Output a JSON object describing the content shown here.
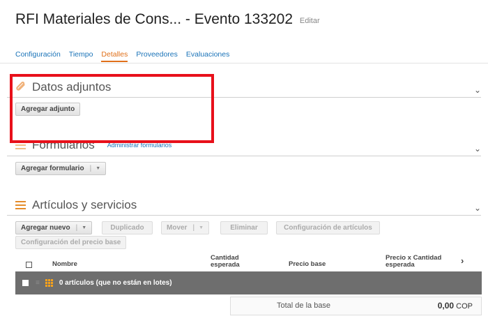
{
  "header": {
    "title": "RFI Materiales de Cons... - Evento 133202",
    "edit_label": "Editar"
  },
  "tabs": [
    {
      "label": "Configuración"
    },
    {
      "label": "Tiempo"
    },
    {
      "label": "Detalles",
      "active": true
    },
    {
      "label": "Proveedores"
    },
    {
      "label": "Evaluaciones"
    }
  ],
  "attachments": {
    "title": "Datos adjuntos",
    "add_button": "Agregar adjunto"
  },
  "forms": {
    "title": "Formularios",
    "manage_link": "Administrar formularios",
    "add_button": "Agregar formulario"
  },
  "items": {
    "title": "Artículos y servicios",
    "toolbar": {
      "add_new": "Agregar nuevo",
      "duplicate": "Duplicado",
      "move": "Mover",
      "delete": "Eliminar",
      "item_config": "Configuración de artículos",
      "base_price_config": "Configuración del precio base"
    },
    "columns": {
      "name": "Nombre",
      "qty_line1": "Cantidad",
      "qty_line2": "esperada",
      "base_price": "Precio base",
      "price_qty_line1": "Precio x Cantidad",
      "price_qty_line2": "esperada"
    },
    "group_row": "0 artículos (que no están en lotes)",
    "total_label": "Total de la base",
    "total_value": "0,00",
    "total_currency": "COP"
  },
  "icons": {
    "chevron": "chevron-down-icon",
    "next": "chevron-right-icon"
  },
  "colors": {
    "link": "#1a73b8",
    "active_tab": "#e0701a",
    "accent_orange": "#e58c2a",
    "highlight_red": "#e8101a",
    "group_row_bg": "#6e6e6e"
  }
}
